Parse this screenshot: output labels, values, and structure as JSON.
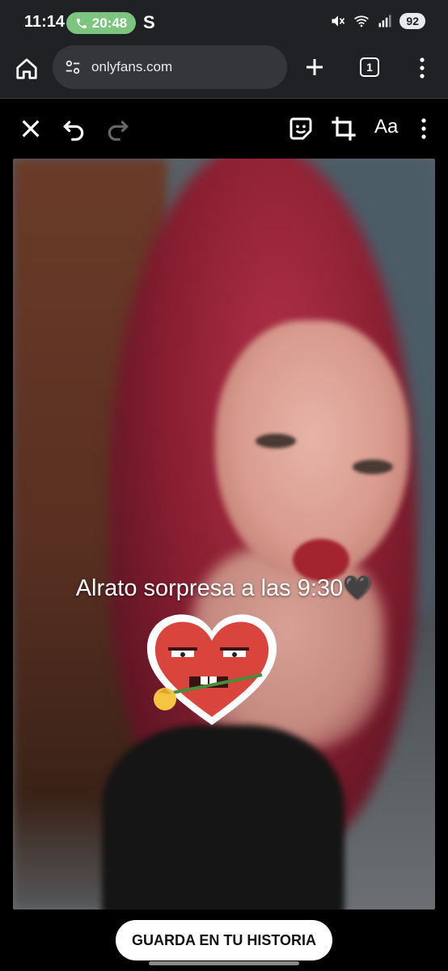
{
  "status_bar": {
    "time": "11:14",
    "call_time": "20:48",
    "carrier_glyph": "S",
    "battery": "92",
    "icons": [
      "phone-icon",
      "mute-icon",
      "wifi-icon",
      "signal-icon"
    ]
  },
  "browser": {
    "url": "onlyfans.com",
    "tab_count": "1",
    "icons": [
      "home-icon",
      "site-info-icon",
      "new-tab-icon",
      "tabs-icon",
      "more-vert-icon"
    ]
  },
  "editor_toolbar": {
    "text_tool_label": "Aa",
    "icons": [
      "close-icon",
      "undo-icon",
      "redo-icon",
      "sticker-icon",
      "crop-icon",
      "more-vert-icon"
    ]
  },
  "story": {
    "caption": "Alrato sorpresa a las 9:30🖤",
    "sticker": "heart-with-rose-sticker"
  },
  "save_button_label": "GUARDA EN TU HISTORIA",
  "colors": {
    "bar_bg": "#202124",
    "url_field_bg": "#35363a",
    "call_pill": "#7bc57f",
    "heart_red": "#d9453c"
  }
}
